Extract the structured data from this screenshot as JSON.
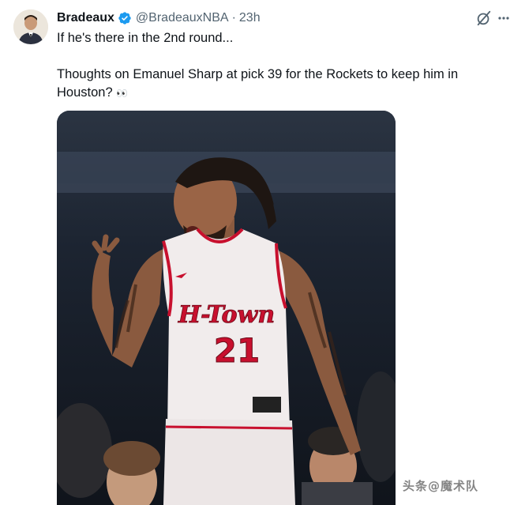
{
  "tweet": {
    "author_name": "Bradeaux",
    "verified_icon": "verified-badge-icon",
    "handle": "@BradeauxNBA",
    "separator": "·",
    "time": "23h",
    "text_line1": "If he's there in the 2nd round...",
    "text_line2": "Thoughts on Emanuel Sharp at pick 39 for the Rockets to keep him in Houston?",
    "text_emoji": "👀",
    "grok_icon": "grok-icon",
    "more_icon": "more-icon"
  },
  "media": {
    "jersey_text": "H-Town",
    "jersey_number": "21",
    "colors": {
      "jersey": "#f1ecec",
      "jersey_trim": "#c8102e",
      "background": "#1b2330"
    }
  },
  "watermark": {
    "text": "头条@魔术队"
  },
  "colors": {
    "verified_blue": "#1d9bf0",
    "secondary_text": "#536471",
    "primary_text": "#0f1419"
  }
}
